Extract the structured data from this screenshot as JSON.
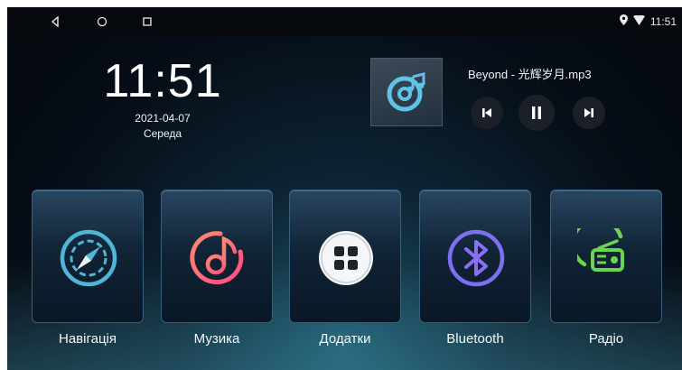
{
  "status_bar": {
    "time": "11:51",
    "nav_icons": [
      "back-icon",
      "home-icon",
      "recents-icon"
    ],
    "status_icons": [
      "location-icon",
      "wifi-icon"
    ]
  },
  "clock": {
    "time": "11:51",
    "date": "2021-04-07",
    "day": "Середа"
  },
  "music": {
    "track": "Beyond - 光辉岁月.mp3",
    "state": "playing",
    "controls": [
      "previous",
      "pause",
      "next"
    ]
  },
  "apps": [
    {
      "label": "Навігація",
      "icon": "compass-icon",
      "color": "#4fb6d8"
    },
    {
      "label": "Музика",
      "icon": "music-note-icon",
      "color": "#ff6d7a"
    },
    {
      "label": "Додатки",
      "icon": "apps-grid-icon",
      "color": "#ffffff"
    },
    {
      "label": "Bluetooth",
      "icon": "bluetooth-icon",
      "color": "#7d6ff0"
    },
    {
      "label": "Радіо",
      "icon": "radio-icon",
      "color": "#6ad64f"
    }
  ]
}
